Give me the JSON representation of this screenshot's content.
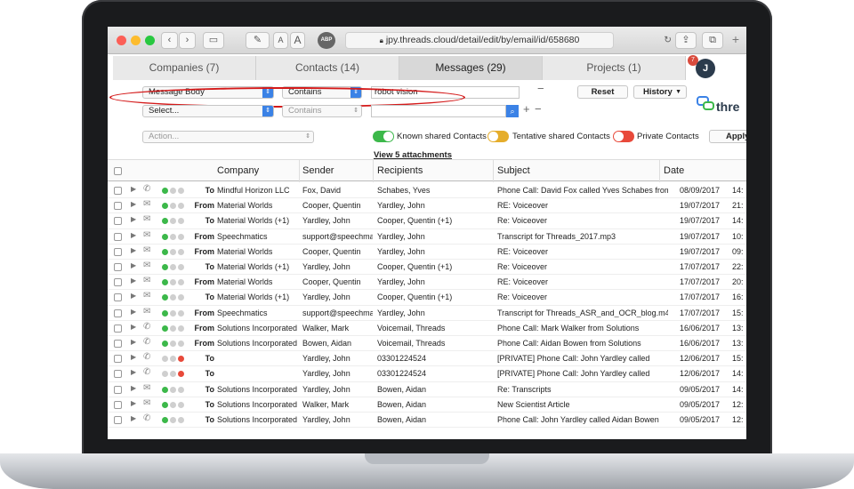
{
  "browser": {
    "url": "jpy.threads.cloud/detail/edit/by/email/id/658680",
    "font_small": "A",
    "font_large": "A",
    "abp": "ABP"
  },
  "tabs": [
    {
      "label": "Companies (7)",
      "active": false
    },
    {
      "label": "Contacts (14)",
      "active": false
    },
    {
      "label": "Messages (29)",
      "active": true
    },
    {
      "label": "Projects (1)",
      "active": false
    }
  ],
  "user": {
    "initial": "J",
    "notifications": "7"
  },
  "filters": {
    "row1": {
      "field": "Message Body",
      "operator": "Contains",
      "value": "robot vision"
    },
    "row2": {
      "field": "Select...",
      "operator": "Contains",
      "value": ""
    },
    "reset_label": "Reset",
    "history_label": "History",
    "action_label": "Action...",
    "apply_label": "Apply",
    "logo_text": "thre"
  },
  "legend": {
    "known": "Known shared Contacts",
    "tentative": "Tentative shared Contacts",
    "private": "Private Contacts",
    "colors": {
      "known": "#3cb84a",
      "tentative": "#e5ad2b",
      "private": "#e8493a"
    }
  },
  "attachments_link": "View 5 attachments",
  "table": {
    "columns": [
      "Company",
      "Sender",
      "Recipients",
      "Subject",
      "Date"
    ],
    "rows": [
      {
        "type": "phone",
        "dots": [
          "g",
          "x",
          "x"
        ],
        "dir": "To",
        "company": "Mindful Horizon LLC",
        "sender": "Fox, David",
        "recipients": "Schabes, Yves",
        "subject": "Phone Call: David Fox called Yves Schabes from",
        "date": "08/09/2017",
        "time": "14:"
      },
      {
        "type": "mail",
        "dots": [
          "g",
          "x",
          "x"
        ],
        "dir": "From",
        "company": "Material Worlds",
        "sender": "Cooper, Quentin",
        "recipients": "Yardley, John",
        "subject": "RE: Voiceover",
        "date": "19/07/2017",
        "time": "21:"
      },
      {
        "type": "mail",
        "dots": [
          "g",
          "x",
          "x"
        ],
        "dir": "To",
        "company": "Material Worlds (+1)",
        "sender": "Yardley, John",
        "recipients": "Cooper, Quentin (+1)",
        "subject": "Re: Voiceover",
        "date": "19/07/2017",
        "time": "14:"
      },
      {
        "type": "mail",
        "dots": [
          "g",
          "x",
          "x"
        ],
        "dir": "From",
        "company": "Speechmatics",
        "sender": "support@speechmatic",
        "recipients": "Yardley, John",
        "subject": "Transcript for Threads_2017.mp3",
        "date": "19/07/2017",
        "time": "10:"
      },
      {
        "type": "mail",
        "dots": [
          "g",
          "x",
          "x"
        ],
        "dir": "From",
        "company": "Material Worlds",
        "sender": "Cooper, Quentin",
        "recipients": "Yardley, John",
        "subject": "RE: Voiceover",
        "date": "19/07/2017",
        "time": "09:"
      },
      {
        "type": "mail",
        "dots": [
          "g",
          "x",
          "x"
        ],
        "dir": "To",
        "company": "Material Worlds (+1)",
        "sender": "Yardley, John",
        "recipients": "Cooper, Quentin (+1)",
        "subject": "Re: Voiceover",
        "date": "17/07/2017",
        "time": "22:"
      },
      {
        "type": "mail",
        "dots": [
          "g",
          "x",
          "x"
        ],
        "dir": "From",
        "company": "Material Worlds",
        "sender": "Cooper, Quentin",
        "recipients": "Yardley, John",
        "subject": "RE: Voiceover",
        "date": "17/07/2017",
        "time": "20:"
      },
      {
        "type": "mail",
        "dots": [
          "g",
          "x",
          "x"
        ],
        "dir": "To",
        "company": "Material Worlds (+1)",
        "sender": "Yardley, John",
        "recipients": "Cooper, Quentin (+1)",
        "subject": "Re: Voiceover",
        "date": "17/07/2017",
        "time": "16:"
      },
      {
        "type": "mail",
        "dots": [
          "g",
          "x",
          "x"
        ],
        "dir": "From",
        "company": "Speechmatics",
        "sender": "support@speechmatic",
        "recipients": "Yardley, John",
        "subject": "Transcript for Threads_ASR_and_OCR_blog.m4a",
        "date": "17/07/2017",
        "time": "15:"
      },
      {
        "type": "phone",
        "dots": [
          "g",
          "x",
          "x"
        ],
        "dir": "From",
        "company": "Solutions Incorporated",
        "sender": "Walker, Mark",
        "recipients": "Voicemail, Threads",
        "subject": "Phone Call: Mark Walker from Solutions",
        "date": "16/06/2017",
        "time": "13:"
      },
      {
        "type": "phone",
        "dots": [
          "g",
          "x",
          "x"
        ],
        "dir": "From",
        "company": "Solutions Incorporated",
        "sender": "Bowen, Aidan",
        "recipients": "Voicemail, Threads",
        "subject": "Phone Call: Aidan Bowen from Solutions",
        "date": "16/06/2017",
        "time": "13:"
      },
      {
        "type": "phone",
        "dots": [
          "x",
          "x",
          "r"
        ],
        "dir": "To",
        "company": "",
        "sender": "Yardley, John",
        "recipients": "03301224524",
        "subject": "[PRIVATE] Phone Call: John Yardley called",
        "date": "12/06/2017",
        "time": "15:"
      },
      {
        "type": "phone",
        "dots": [
          "x",
          "x",
          "r"
        ],
        "dir": "To",
        "company": "",
        "sender": "Yardley, John",
        "recipients": "03301224524",
        "subject": "[PRIVATE] Phone Call: John Yardley called",
        "date": "12/06/2017",
        "time": "14:"
      },
      {
        "type": "mail",
        "dots": [
          "g",
          "x",
          "x"
        ],
        "dir": "To",
        "company": "Solutions Incorporated",
        "sender": "Yardley, John",
        "recipients": "Bowen, Aidan",
        "subject": "Re: Transcripts",
        "date": "09/05/2017",
        "time": "14:"
      },
      {
        "type": "mail",
        "dots": [
          "g",
          "x",
          "x"
        ],
        "dir": "To",
        "company": "Solutions Incorporated",
        "sender": "Walker, Mark",
        "recipients": "Bowen, Aidan",
        "subject": "New Scientist Article",
        "date": "09/05/2017",
        "time": "12:"
      },
      {
        "type": "phone",
        "dots": [
          "g",
          "x",
          "x"
        ],
        "dir": "To",
        "company": "Solutions Incorporated",
        "sender": "Yardley, John",
        "recipients": "Bowen, Aidan",
        "subject": "Phone Call: John Yardley called Aidan Bowen",
        "date": "09/05/2017",
        "time": "12:"
      }
    ]
  }
}
